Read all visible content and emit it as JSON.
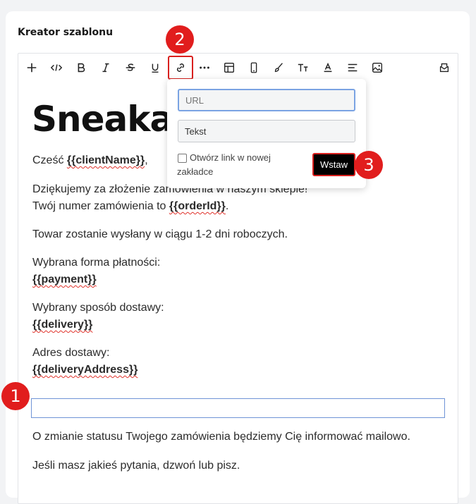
{
  "card": {
    "title": "Kreator szablonu"
  },
  "toolbar": {
    "icons": [
      "plus-icon",
      "code-icon",
      "bold-icon",
      "italic-icon",
      "strikethrough-icon",
      "underline-icon",
      "link-icon",
      "more-icon",
      "table-icon",
      "mobile-icon",
      "brush-icon",
      "font-size-icon",
      "font-color-icon",
      "align-icon",
      "image-icon",
      "mail-icon"
    ]
  },
  "email": {
    "logo": "Sneakair",
    "greeting_prefix": "Cześć ",
    "client_var": "{{clientName}}",
    "greeting_suffix": ",",
    "thanks_line1": "Dziękujemy za złożenie zamówienia w naszym sklepie!",
    "thanks_line2_prefix": "Twój numer zamówienia to ",
    "order_var": "{{orderId}}",
    "thanks_line2_suffix": ".",
    "shipping_line": "Towar zostanie wysłany w ciągu 1-2 dni roboczych.",
    "payment_label": "Wybrana forma płatności:",
    "payment_var": "{{payment}}",
    "delivery_label": "Wybrany sposób dostawy:",
    "delivery_var": "{{delivery}}",
    "address_label": "Adres dostawy:",
    "address_var": "{{deliveryAddress}}",
    "status_line": "O zmianie statusu Twojego zamówienia będziemy Cię informować mailowo.",
    "questions_line": "Jeśli masz jakieś pytania, dzwoń lub pisz."
  },
  "link_popup": {
    "url_placeholder": "URL",
    "text_value": "Tekst",
    "new_tab_label": "Otwórz link w nowej zakładce",
    "insert_label": "Wstaw"
  },
  "badges": {
    "one": "1",
    "two": "2",
    "three": "3"
  },
  "colors": {
    "accent_red": "#e11d1d",
    "focus_blue": "#6f94d6"
  }
}
